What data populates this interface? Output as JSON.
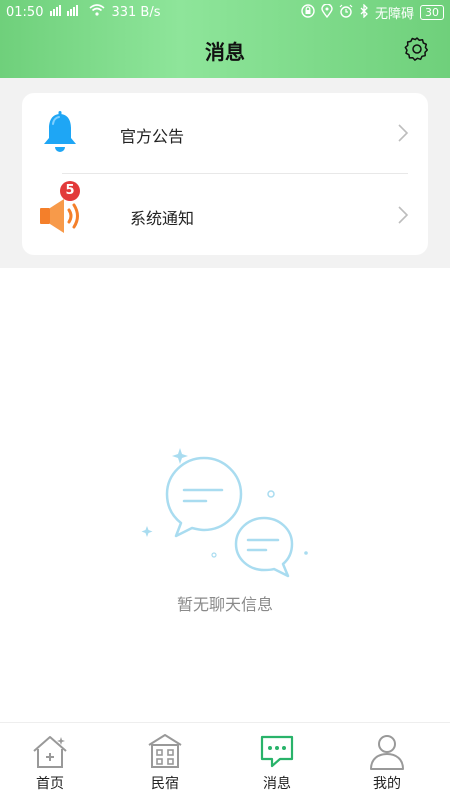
{
  "status_bar": {
    "time": "01:50",
    "network_speed": "331 B/s",
    "carrier": "无障碍",
    "battery": "30"
  },
  "header": {
    "title": "消息"
  },
  "list": {
    "items": [
      {
        "label": "官方公告",
        "icon": "bell-icon"
      },
      {
        "label": "系统通知",
        "icon": "speaker-icon",
        "badge": "5"
      }
    ]
  },
  "empty_state": {
    "text": "暂无聊天信息",
    "icon": "chat-bubbles-icon"
  },
  "bottom_nav": {
    "tabs": [
      {
        "label": "首页",
        "icon": "home-icon"
      },
      {
        "label": "民宿",
        "icon": "building-icon"
      },
      {
        "label": "消息",
        "icon": "message-icon",
        "active": true
      },
      {
        "label": "我的",
        "icon": "user-icon"
      }
    ]
  },
  "colors": {
    "header_green": "#6fd07b",
    "accent_green": "#29b36a",
    "badge_red": "#e23a3a",
    "bell_blue": "#1ea6f5",
    "speaker_orange": "#f47f2a"
  }
}
